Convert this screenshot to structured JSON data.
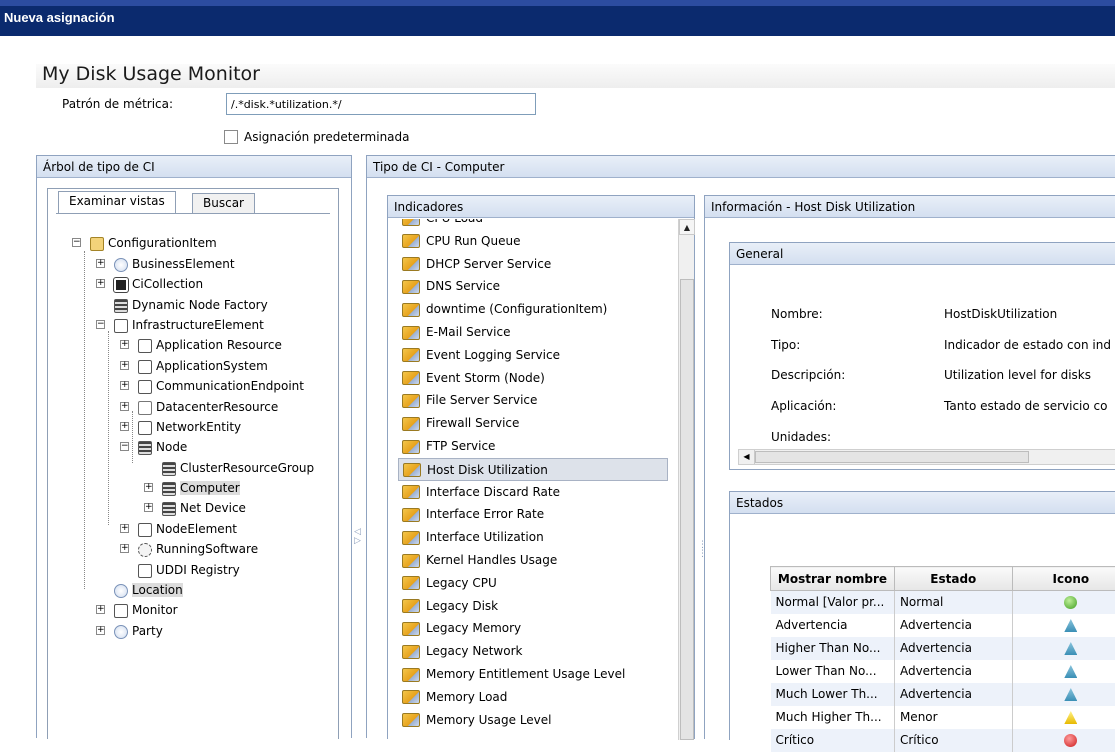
{
  "window": {
    "title": "Nueva asignación"
  },
  "page": {
    "title": "My Disk Usage  Monitor"
  },
  "form": {
    "metric_label": "Patrón de métrica:",
    "metric_value": "/.*disk.*utilization.*/",
    "default_assignment_label": "Asignación predeterminada",
    "default_assignment_checked": false
  },
  "ci_tree_panel": {
    "title": "Árbol de tipo de CI",
    "tabs": [
      {
        "label": "Examinar vistas",
        "active": true
      },
      {
        "label": "Buscar",
        "active": false
      }
    ],
    "nodes": [
      {
        "label": "ConfigurationItem",
        "icon": "configuration-item-icon",
        "expander": "-"
      },
      {
        "label": "BusinessElement",
        "icon": "globe-icon",
        "expander": "+"
      },
      {
        "label": "CiCollection",
        "icon": "collection-icon",
        "expander": "+"
      },
      {
        "label": "Dynamic Node Factory",
        "icon": "server-icon",
        "expander": ""
      },
      {
        "label": "InfrastructureElement",
        "icon": "infrastructure-icon",
        "expander": "-"
      },
      {
        "label": "Application Resource",
        "icon": "application-resource-icon",
        "expander": "+"
      },
      {
        "label": "ApplicationSystem",
        "icon": "application-system-icon",
        "expander": "+"
      },
      {
        "label": "CommunicationEndpoint",
        "icon": "endpoint-icon",
        "expander": "+"
      },
      {
        "label": "DatacenterResource",
        "icon": "flag-icon",
        "expander": "+"
      },
      {
        "label": "NetworkEntity",
        "icon": "network-icon",
        "expander": "+"
      },
      {
        "label": "Node",
        "icon": "node-icon",
        "expander": "-"
      },
      {
        "label": "ClusterResourceGroup",
        "icon": "server-icon",
        "expander": ""
      },
      {
        "label": "Computer",
        "icon": "server-icon",
        "expander": "+"
      },
      {
        "label": "Net Device",
        "icon": "server-icon",
        "expander": "+"
      },
      {
        "label": "NodeElement",
        "icon": "node-element-icon",
        "expander": "+"
      },
      {
        "label": "RunningSoftware",
        "icon": "gear-icon",
        "expander": "+"
      },
      {
        "label": "UDDI Registry",
        "icon": "registry-icon",
        "expander": ""
      },
      {
        "label": "Location",
        "icon": "globe-icon",
        "expander": ""
      },
      {
        "label": "Monitor",
        "icon": "monitor-icon",
        "expander": "+"
      },
      {
        "label": "Party",
        "icon": "globe-icon",
        "expander": "+"
      }
    ],
    "selected": [
      "Computer",
      "Location"
    ]
  },
  "ci_type_panel": {
    "title": "Tipo de CI - Computer"
  },
  "indicators_panel": {
    "title": "Indicadores",
    "items": [
      "CPU Load",
      "CPU Run Queue",
      "DHCP Server Service",
      "DNS Service",
      "downtime (ConfigurationItem)",
      "E-Mail Service",
      "Event Logging Service",
      "Event Storm (Node)",
      "File Server Service",
      "Firewall Service",
      "FTP Service",
      "Host Disk Utilization",
      "Interface Discard Rate",
      "Interface Error Rate",
      "Interface Utilization",
      "Kernel Handles Usage",
      "Legacy CPU",
      "Legacy Disk",
      "Legacy Memory",
      "Legacy Network",
      "Memory Entitlement Usage Level",
      "Memory Load",
      "Memory Usage Level"
    ],
    "selected": "Host Disk Utilization"
  },
  "info_panel": {
    "title": "Información - Host Disk Utilization",
    "general": {
      "title": "General",
      "rows": [
        {
          "label": "Nombre:",
          "value": "HostDiskUtilization"
        },
        {
          "label": "Tipo:",
          "value": "Indicador de estado con ind"
        },
        {
          "label": "Descripción:",
          "value": "Utilization level for disks"
        },
        {
          "label": "Aplicación:",
          "value": "Tanto estado de servicio co"
        },
        {
          "label": "Unidades:",
          "value": ""
        }
      ]
    },
    "states": {
      "title": "Estados",
      "headers": [
        "Mostrar nombre",
        "Estado",
        "Icono"
      ],
      "rows": [
        {
          "name": "Normal [Valor pr...",
          "state": "Normal",
          "icon": "ok-icon"
        },
        {
          "name": "Advertencia",
          "state": "Advertencia",
          "icon": "warning-blue-icon"
        },
        {
          "name": "Higher Than No...",
          "state": "Advertencia",
          "icon": "warning-blue-icon"
        },
        {
          "name": "Lower Than No...",
          "state": "Advertencia",
          "icon": "warning-blue-icon"
        },
        {
          "name": "Much Lower Th...",
          "state": "Advertencia",
          "icon": "warning-blue-icon"
        },
        {
          "name": "Much Higher Th...",
          "state": "Menor",
          "icon": "warning-yellow-icon"
        },
        {
          "name": "Crítico",
          "state": "Crítico",
          "icon": "critical-icon"
        }
      ]
    }
  }
}
